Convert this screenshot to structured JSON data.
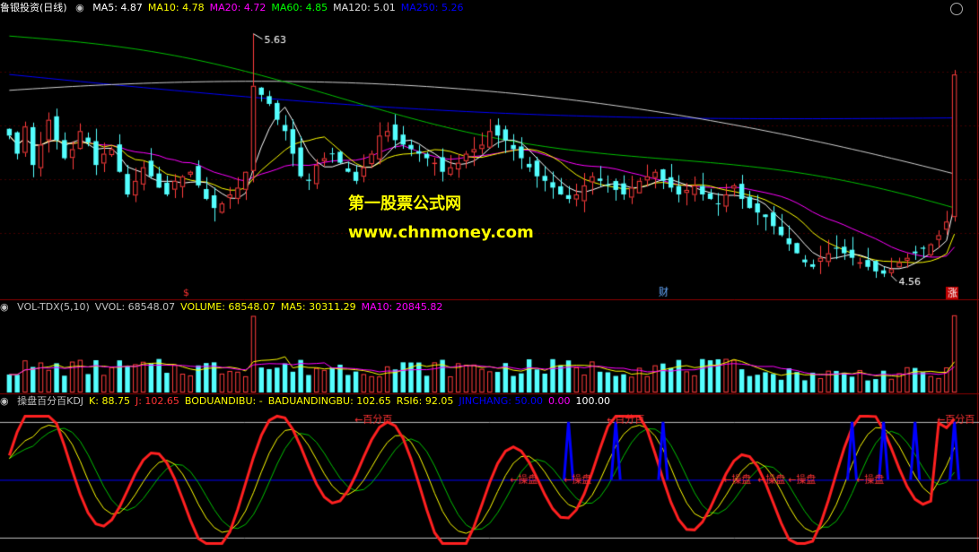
{
  "main_header": {
    "title": "鲁银投资(日线)",
    "items": [
      {
        "label": "MA5: 4.87",
        "color": "#ffffff"
      },
      {
        "label": "MA10: 4.78",
        "color": "#ffff00"
      },
      {
        "label": "MA20: 4.72",
        "color": "#ff00ff"
      },
      {
        "label": "MA60: 4.85",
        "color": "#00ff00"
      },
      {
        "label": "MA120: 5.01",
        "color": "#e0e0e0"
      },
      {
        "label": "MA250: 5.26",
        "color": "#0000ff"
      }
    ]
  },
  "vol_header": {
    "items": [
      {
        "label": "VOL-TDX(5,10)",
        "color": "#c0c0c0"
      },
      {
        "label": "VVOL: 68548.07",
        "color": "#c0c0c0"
      },
      {
        "label": "VOLUME: 68548.07",
        "color": "#ffff00"
      },
      {
        "label": "MA5: 30311.29",
        "color": "#ffff00"
      },
      {
        "label": "MA10: 20845.82",
        "color": "#ff00ff"
      }
    ]
  },
  "kdj_header": {
    "items": [
      {
        "label": "操盘百分百KDJ",
        "color": "#c0c0c0"
      },
      {
        "label": "K: 88.75",
        "color": "#ffff00"
      },
      {
        "label": "J: 102.65",
        "color": "#ff3333"
      },
      {
        "label": "BODUANDIBU: -",
        "color": "#ffff00"
      },
      {
        "label": "BADUANDINGBU: 102.65",
        "color": "#ffff00"
      },
      {
        "label": "RSI6: 92.05",
        "color": "#ffff00"
      },
      {
        "label": "JINCHANG: 50.00",
        "color": "#0000ff"
      },
      {
        "label": "0.00",
        "color": "#ff00ff"
      },
      {
        "label": "100.00",
        "color": "#ffffff"
      }
    ]
  },
  "watermark": {
    "line1": "第一股票公式网",
    "line2": "www.chnmoney.com"
  },
  "chart_data": {
    "type": "candlestick",
    "high_label": "5.63",
    "low_label": "4.56",
    "markers": [
      "$",
      "财",
      "涨"
    ],
    "kdj_annotations": [
      "←百分百",
      "←百分百",
      "←百分百",
      "←操盘",
      "←操盘",
      "←操盘",
      "←操盘",
      "←操盘",
      "←操盘"
    ],
    "closes": [
      5.18,
      5.1,
      5.22,
      5.05,
      5.14,
      5.25,
      5.16,
      5.08,
      5.12,
      5.2,
      5.15,
      5.05,
      5.1,
      5.12,
      5.02,
      4.92,
      4.98,
      5.04,
      5.0,
      4.95,
      4.92,
      4.98,
      5.0,
      5.02,
      4.96,
      4.9,
      4.86,
      4.88,
      4.92,
      4.95,
      5.02,
      5.4,
      5.36,
      5.32,
      5.25,
      5.2,
      5.1,
      5.0,
      4.98,
      5.05,
      5.08,
      5.1,
      5.06,
      5.02,
      4.98,
      5.04,
      5.1,
      5.18,
      5.2,
      5.16,
      5.14,
      5.12,
      5.1,
      5.08,
      5.06,
      5.02,
      5.04,
      5.06,
      5.1,
      5.12,
      5.14,
      5.2,
      5.18,
      5.16,
      5.12,
      5.08,
      5.04,
      5.0,
      4.98,
      4.95,
      4.92,
      4.9,
      4.92,
      4.96,
      5.0,
      4.98,
      4.96,
      4.94,
      4.92,
      4.95,
      4.98,
      5.0,
      5.02,
      4.98,
      4.95,
      4.92,
      4.94,
      4.96,
      4.92,
      4.9,
      4.88,
      4.92,
      4.96,
      4.9,
      4.86,
      4.84,
      4.82,
      4.78,
      4.74,
      4.7,
      4.66,
      4.62,
      4.6,
      4.64,
      4.66,
      4.68,
      4.66,
      4.64,
      4.62,
      4.6,
      4.58,
      4.57,
      4.59,
      4.62,
      4.64,
      4.66,
      4.68,
      4.7,
      4.74,
      4.8,
      5.45
    ]
  }
}
